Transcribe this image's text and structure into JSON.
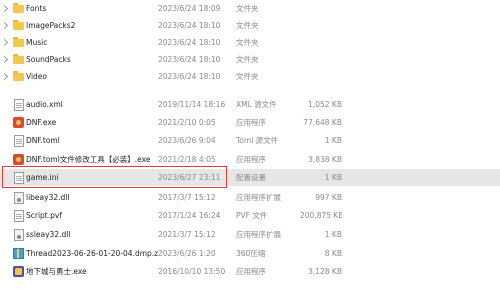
{
  "files": [
    {
      "name": "Fonts",
      "date": "2023/6/24 18:09",
      "type": "文件夹",
      "size": "",
      "icon": "folder-icon"
    },
    {
      "name": "ImagePacks2",
      "date": "2023/6/24 18:10",
      "type": "文件夹",
      "size": "",
      "icon": "folder-icon"
    },
    {
      "name": "Music",
      "date": "2023/6/24 18:10",
      "type": "文件夹",
      "size": "",
      "icon": "folder-icon"
    },
    {
      "name": "SoundPacks",
      "date": "2023/6/24 18:10",
      "type": "文件夹",
      "size": "",
      "icon": "folder-icon"
    },
    {
      "name": "Video",
      "date": "2023/6/24 18:10",
      "type": "文件夹",
      "size": "",
      "icon": "folder-icon"
    },
    {
      "name": "audio.xml",
      "date": "2019/11/14 18:16",
      "type": "XML 源文件",
      "size": "1,052 KB",
      "icon": "document-icon"
    },
    {
      "name": "DNF.exe",
      "date": "2021/2/10 0:05",
      "type": "应用程序",
      "size": "77,648 KB",
      "icon": "application-icon"
    },
    {
      "name": "DNF.toml",
      "date": "2023/6/26 9:04",
      "type": "Toml 源文件",
      "size": "1 KB",
      "icon": "document-icon"
    },
    {
      "name": "DNF.toml文件修改工具【必装】.exe",
      "date": "2021/2/18 4:05",
      "type": "应用程序",
      "size": "3,838 KB",
      "icon": "tool-icon"
    },
    {
      "name": "game.ini",
      "date": "2023/6/27 23:11",
      "type": "配置设置",
      "size": "1 KB",
      "icon": "settings-file-icon"
    },
    {
      "name": "libeay32.dll",
      "date": "2017/3/7 15:12",
      "type": "应用程序扩展",
      "size": "997 KB",
      "icon": "dll-icon"
    },
    {
      "name": "Script.pvf",
      "date": "2017/1/24 16:24",
      "type": "PVF 文件",
      "size": "200,875 KB",
      "icon": "document-icon"
    },
    {
      "name": "ssleay32.dll",
      "date": "2021/3/7 15:12",
      "type": "应用程序扩展",
      "size": "1 KB",
      "icon": "dll-icon"
    },
    {
      "name": "Thread2023-06-26-01-20-04.dmp.z",
      "date": "2023/6/26 1:20",
      "type": "360压缩",
      "size": "8 KB",
      "icon": "archive-icon"
    },
    {
      "name": "地下城与勇士.exe",
      "date": "2016/10/10 13:50",
      "type": "应用程序",
      "size": "3,128 KB",
      "icon": "game-icon"
    }
  ],
  "highlight_color": "#e03a3a",
  "selected_row": 9
}
